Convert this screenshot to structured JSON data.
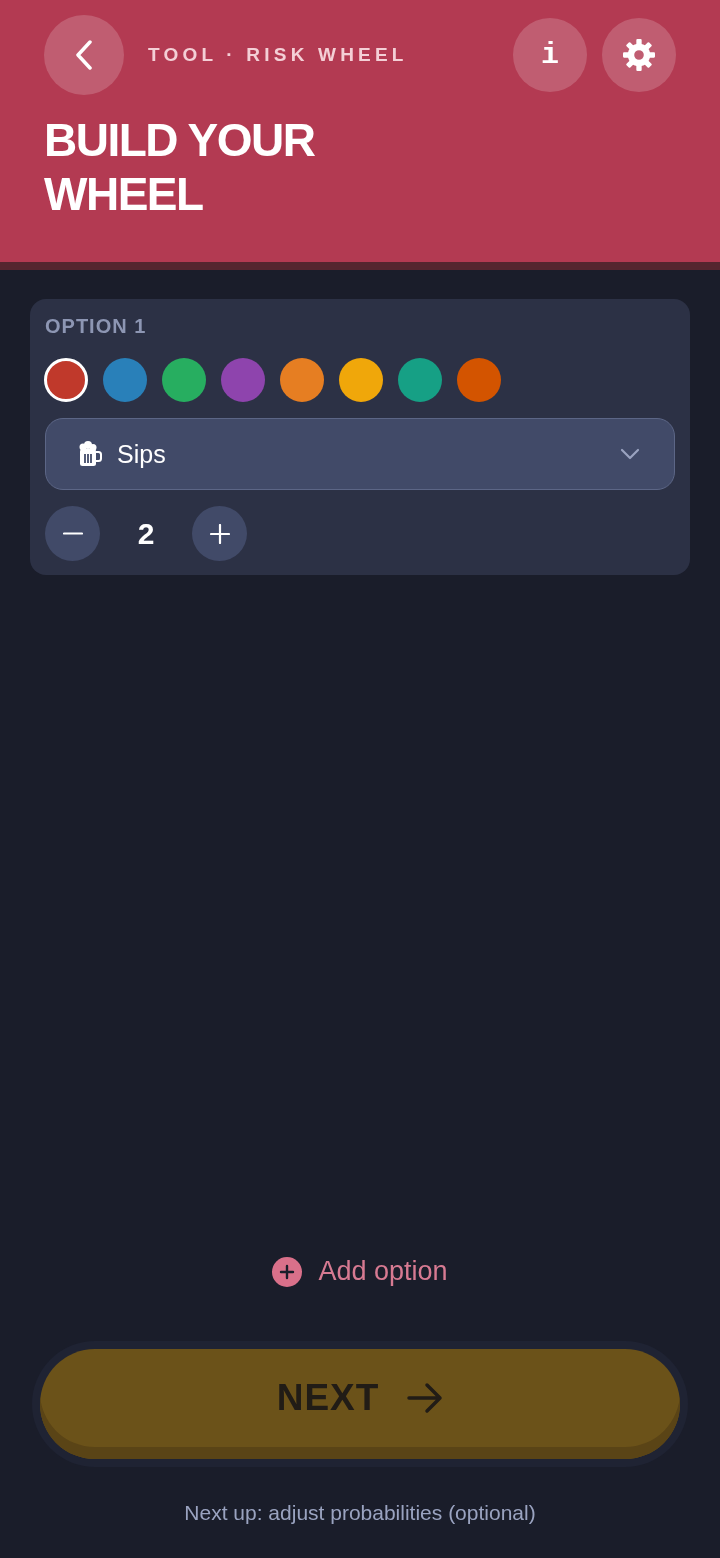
{
  "header": {
    "subtitle": "TOOL · RISK WHEEL",
    "title": "BUILD YOUR WHEEL",
    "info_button": {
      "label": "i"
    }
  },
  "options": [
    {
      "label": "OPTION 1",
      "swatches": [
        {
          "color": "#c0392b",
          "selected": true
        },
        {
          "color": "#2980b9",
          "selected": false
        },
        {
          "color": "#27ae60",
          "selected": false
        },
        {
          "color": "#8e44ad",
          "selected": false
        },
        {
          "color": "#e67e22",
          "selected": false
        },
        {
          "color": "#f0a70a",
          "selected": false
        },
        {
          "color": "#16a085",
          "selected": false
        },
        {
          "color": "#d35400",
          "selected": false
        }
      ],
      "type_select": {
        "value": "Sips"
      },
      "count": "2"
    }
  ],
  "add_option": {
    "label": "Add option"
  },
  "next_button": {
    "label": "NEXT",
    "disabled": true
  },
  "footer_hint": "Next up: adjust probabilities (optional)"
}
